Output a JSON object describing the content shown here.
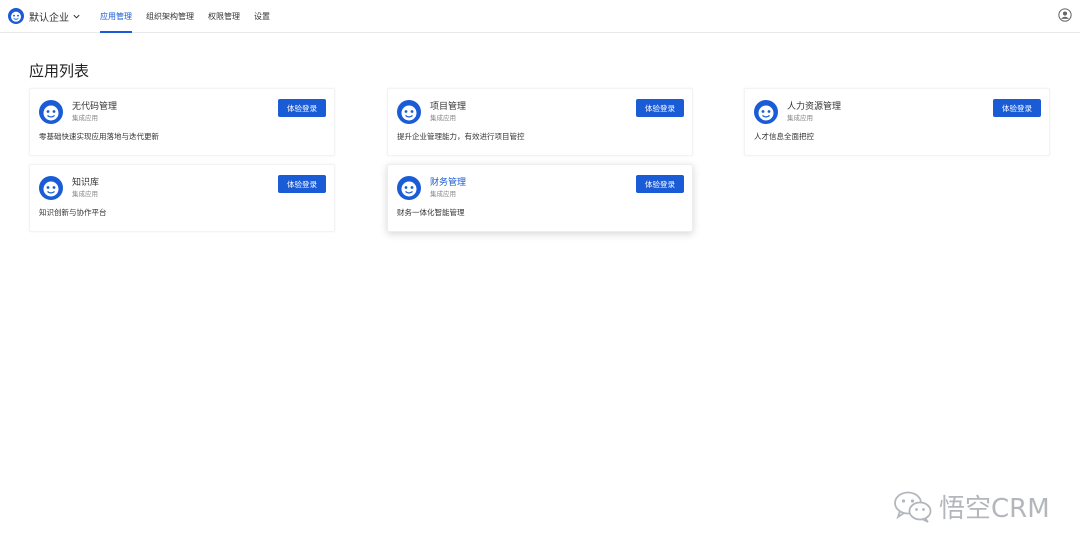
{
  "header": {
    "company": "默认企业",
    "nav": [
      "应用管理",
      "组织架构管理",
      "权限管理",
      "设置"
    ],
    "active_index": 0
  },
  "page": {
    "title": "应用列表"
  },
  "apps": [
    {
      "name": "无代码管理",
      "tag": "集成应用",
      "desc": "零基础快速实现应用落地与迭代更新",
      "button": "体验登录"
    },
    {
      "name": "项目管理",
      "tag": "集成应用",
      "desc": "提升企业管理能力，有效进行项目管控",
      "button": "体验登录"
    },
    {
      "name": "人力资源管理",
      "tag": "集成应用",
      "desc": "人才信息全面把控",
      "button": "体验登录"
    },
    {
      "name": "知识库",
      "tag": "集成应用",
      "desc": "知识创新与协作平台",
      "button": "体验登录"
    },
    {
      "name": "财务管理",
      "tag": "集成应用",
      "desc": "财务一体化智能管理",
      "button": "体验登录"
    }
  ],
  "watermark": {
    "text": "悟空CRM"
  },
  "colors": {
    "accent": "#1a5bd6"
  }
}
